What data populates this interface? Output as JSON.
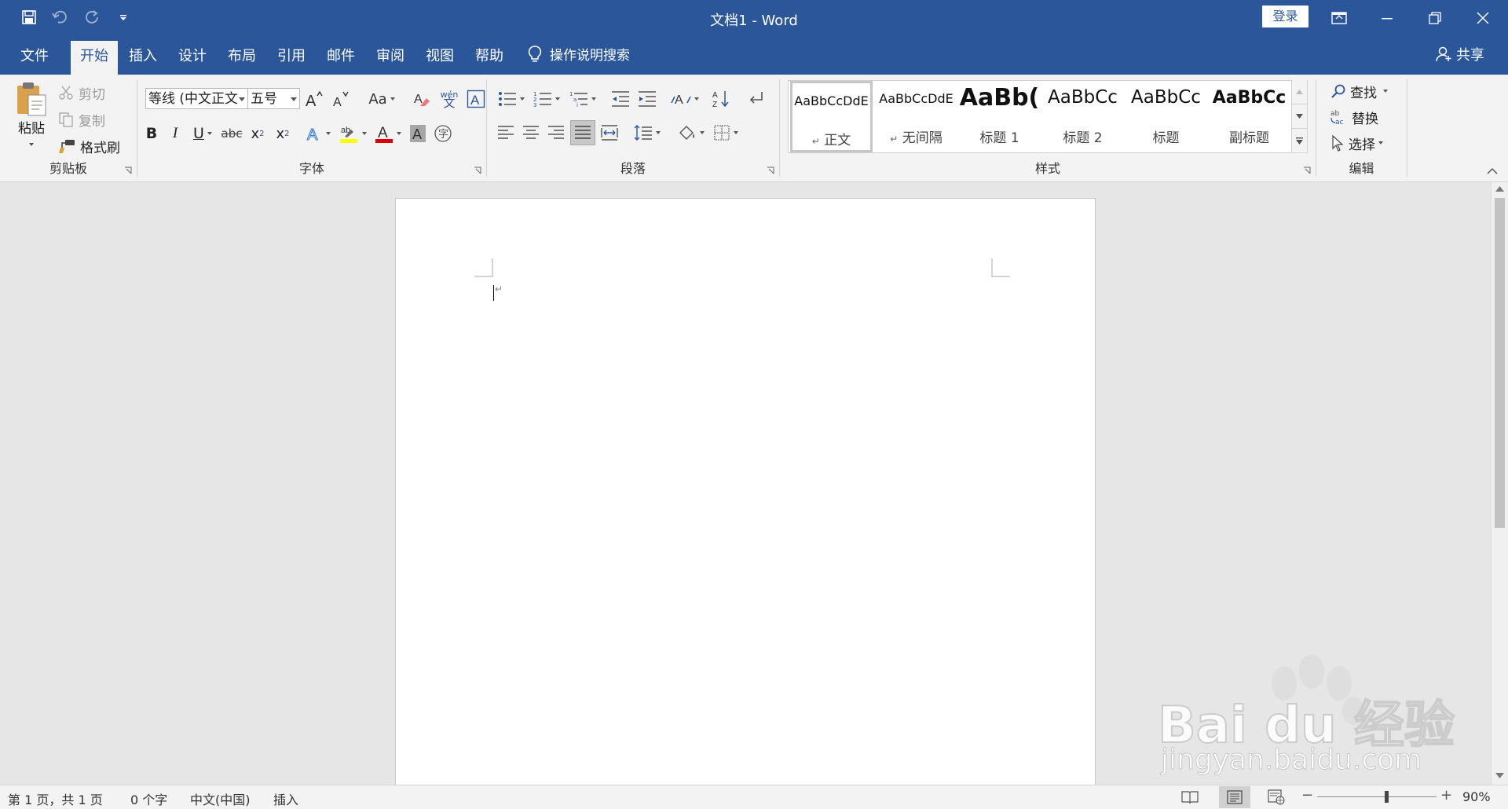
{
  "window": {
    "title": "文档1  -  Word",
    "login_label": "登录"
  },
  "menu": {
    "tabs": [
      {
        "label": "文件"
      },
      {
        "label": "开始"
      },
      {
        "label": "插入"
      },
      {
        "label": "设计"
      },
      {
        "label": "布局"
      },
      {
        "label": "引用"
      },
      {
        "label": "邮件"
      },
      {
        "label": "审阅"
      },
      {
        "label": "视图"
      },
      {
        "label": "帮助"
      }
    ],
    "active_tab": "开始",
    "tell_me": "操作说明搜索",
    "share": "共享"
  },
  "ribbon": {
    "clipboard": {
      "label": "剪贴板",
      "paste": "粘贴",
      "cut": "剪切",
      "copy": "复制",
      "format_painter": "格式刷"
    },
    "font": {
      "label": "字体",
      "font_name": "等线 (中文正文",
      "font_size": "五号",
      "change_case": "Aa",
      "phonetic_top": "wén",
      "phonetic_bottom": "文"
    },
    "paragraph": {
      "label": "段落"
    },
    "styles": {
      "label": "样式",
      "items": [
        {
          "preview": "AaBbCcDdE",
          "name": "正文",
          "mark": "↵"
        },
        {
          "preview": "AaBbCcDdE",
          "name": "无间隔",
          "mark": "↵"
        },
        {
          "preview": "AaBb(",
          "name": "标题 1",
          "mark": ""
        },
        {
          "preview": "AaBbCc",
          "name": "标题 2",
          "mark": ""
        },
        {
          "preview": "AaBbCc",
          "name": "标题",
          "mark": ""
        },
        {
          "preview": "AaBbCc",
          "name": "副标题",
          "mark": ""
        }
      ]
    },
    "editing": {
      "label": "编辑",
      "find": "查找",
      "replace": "替换",
      "select": "选择"
    }
  },
  "document": {
    "paragraph_mark": "↵"
  },
  "status": {
    "page": "第 1 页，共 1 页",
    "words": "0 个字",
    "language": "中文(中国)",
    "mode": "插入",
    "zoom_level": "90%",
    "zoom_fraction": 0.58
  },
  "watermark": {
    "brand": "Bai du 经验",
    "url": "jingyan.baidu.com"
  },
  "colors": {
    "accent": "#2b579a",
    "highlight": "#ffff00",
    "font_color": "#e00000"
  }
}
